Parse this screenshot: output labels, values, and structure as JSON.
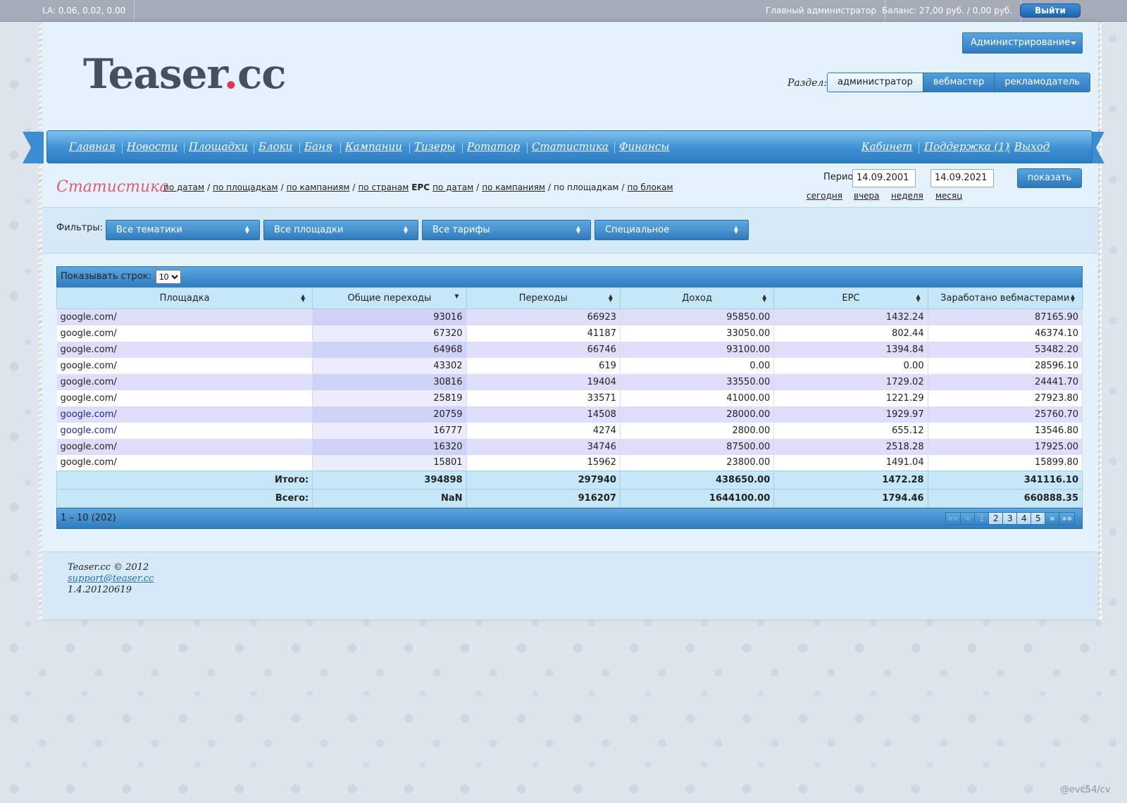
{
  "topbar": {
    "la": "LA: 0.06, 0.02, 0.00",
    "admin": "Главный администратор",
    "balance": "Баланс: 27,00 руб. / 0,00 руб.",
    "logout": "Выйти"
  },
  "logo": {
    "main": "Teaser",
    "dot": ".",
    "tld": "cc"
  },
  "admin_menu": "Администрирование",
  "section": {
    "label": "Раздел:",
    "items": [
      "администратор",
      "вебмастер",
      "рекламодатель"
    ],
    "active": 0
  },
  "nav": {
    "left": [
      "Главная",
      "Новости",
      "Площадки",
      "Блоки",
      "Баня",
      "Кампании",
      "Тизеры",
      "Ротатор",
      "Статистика",
      "Финансы"
    ],
    "right": [
      "Кабинет",
      "Поддержка (1)",
      "Выход"
    ]
  },
  "stats": {
    "title": "Статистика",
    "links": [
      {
        "t": "по датам",
        "k": "lnk"
      },
      {
        "t": "/",
        "k": ""
      },
      {
        "t": "по площадкам",
        "k": "lnk"
      },
      {
        "t": "/",
        "k": ""
      },
      {
        "t": "по кампаниям",
        "k": "lnk"
      },
      {
        "t": "/",
        "k": ""
      },
      {
        "t": "по странам",
        "k": "lnk"
      },
      {
        "t": "EPC",
        "k": "b"
      },
      {
        "t": "по датам",
        "k": "lnk"
      },
      {
        "t": "/",
        "k": ""
      },
      {
        "t": "по кампаниям",
        "k": "lnk"
      },
      {
        "t": "/",
        "k": ""
      },
      {
        "t": "по площадкам",
        "k": ""
      },
      {
        "t": "/",
        "k": ""
      },
      {
        "t": "по блокам",
        "k": "lnk"
      }
    ]
  },
  "period": {
    "label": "Период:",
    "from": "14.09.2001",
    "dash": "—",
    "to": "14.09.2021",
    "show": "показать",
    "quick": [
      "сегодня",
      "вчера",
      "неделя",
      "месяц"
    ]
  },
  "filters": {
    "label": "Фильтры:",
    "selects": [
      "Все тематики",
      "Все площадки",
      "Все тарифы",
      "Специальное"
    ]
  },
  "table": {
    "rows_label": "Показывать строк:",
    "rows_value": "10",
    "columns": [
      "Площадка",
      "Общие переходы",
      "Переходы",
      "Доход",
      "EPC",
      "Заработано вебмастерами"
    ],
    "rows": [
      [
        "google.com/",
        "93016",
        "66923",
        "95850.00",
        "1432.24",
        "87165.90"
      ],
      [
        "google.com/",
        "67320",
        "41187",
        "33050.00",
        "802.44",
        "46374.10"
      ],
      [
        "google.com/",
        "64968",
        "66746",
        "93100.00",
        "1394.84",
        "53482.20"
      ],
      [
        "google.com/",
        "43302",
        "619",
        "0.00",
        "0.00",
        "28596.10"
      ],
      [
        "google.com/",
        "30816",
        "19404",
        "33550.00",
        "1729.02",
        "24441.70"
      ],
      [
        "google.com/",
        "25819",
        "33571",
        "41000.00",
        "1221.29",
        "27923.80"
      ],
      [
        "google.com/",
        "20759",
        "14508",
        "28000.00",
        "1929.97",
        "25760.70"
      ],
      [
        "google.com/",
        "16777",
        "4274",
        "2800.00",
        "655.12",
        "13546.80"
      ],
      [
        "google.com/",
        "16320",
        "34746",
        "87500.00",
        "2518.28",
        "17925.00"
      ],
      [
        "google.com/",
        "15801",
        "15962",
        "23800.00",
        "1491.04",
        "15899.80"
      ]
    ],
    "totals": [
      [
        "Итого:",
        "394898",
        "297940",
        "438650.00",
        "1472.28",
        "341116.10"
      ],
      [
        "Всего:",
        "NaN",
        "916207",
        "1644100.00",
        "1794.46",
        "660888.35"
      ]
    ],
    "range": "1 – 10 (202)",
    "pager": [
      "««",
      "«",
      "1",
      "2",
      "3",
      "4",
      "5",
      "»",
      "»»"
    ]
  },
  "footer": {
    "copy": "Teaser.cc © 2012",
    "email": "support@teaser.cc",
    "version": "1.4.20120619"
  },
  "watermark": "@evc54/cv"
}
